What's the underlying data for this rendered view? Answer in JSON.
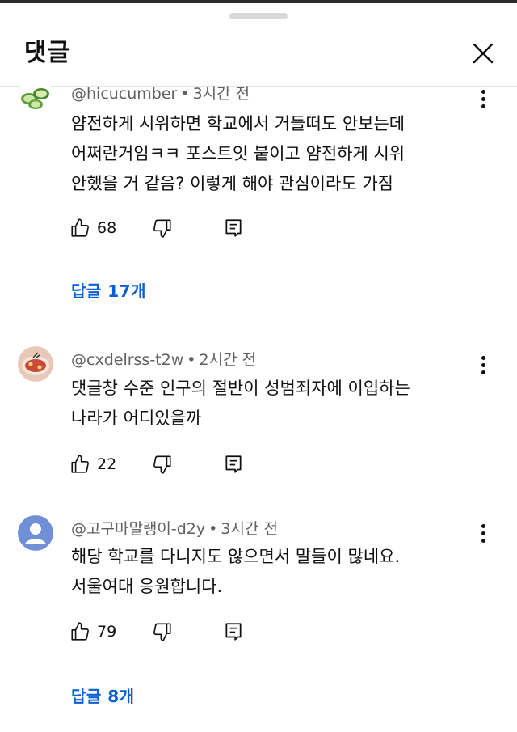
{
  "panel": {
    "title": "댓글"
  },
  "comments": [
    {
      "handle": "@hicucumber",
      "separator": "•",
      "time": "3시간 전",
      "avatar": "cucumber-avatar",
      "lines": [
        "얌전하게 시위하면 학교에서 거들떠도 안보는데",
        "어쩌란거임ㅋㅋ 포스트잇 붙이고 얌전하게 시위",
        "안했을 거 같음? 이렇게 해야 관심이라도 가짐"
      ],
      "likes": "68",
      "replies_label": "답글 17개"
    },
    {
      "handle": "@cxdelrss-t2w",
      "separator": "•",
      "time": "2시간 전",
      "avatar": "food-avatar",
      "lines": [
        "댓글창 수준 인구의 절반이 성범죄자에 이입하는",
        "나라가 어디있을까"
      ],
      "likes": "22",
      "replies_label": ""
    },
    {
      "handle": "@고구마말랭이-d2y",
      "separator": "•",
      "time": "3시간 전",
      "avatar": "default-person-avatar",
      "lines": [
        "해당 학교를 다니지도 않으면서 말들이 많네요.",
        "서울여대 응원합니다."
      ],
      "likes": "79",
      "replies_label": "답글 8개"
    }
  ],
  "colors": {
    "link_blue": "#065fd4",
    "secondary_text": "#606060",
    "default_avatar_bg": "#6f8fd6"
  }
}
